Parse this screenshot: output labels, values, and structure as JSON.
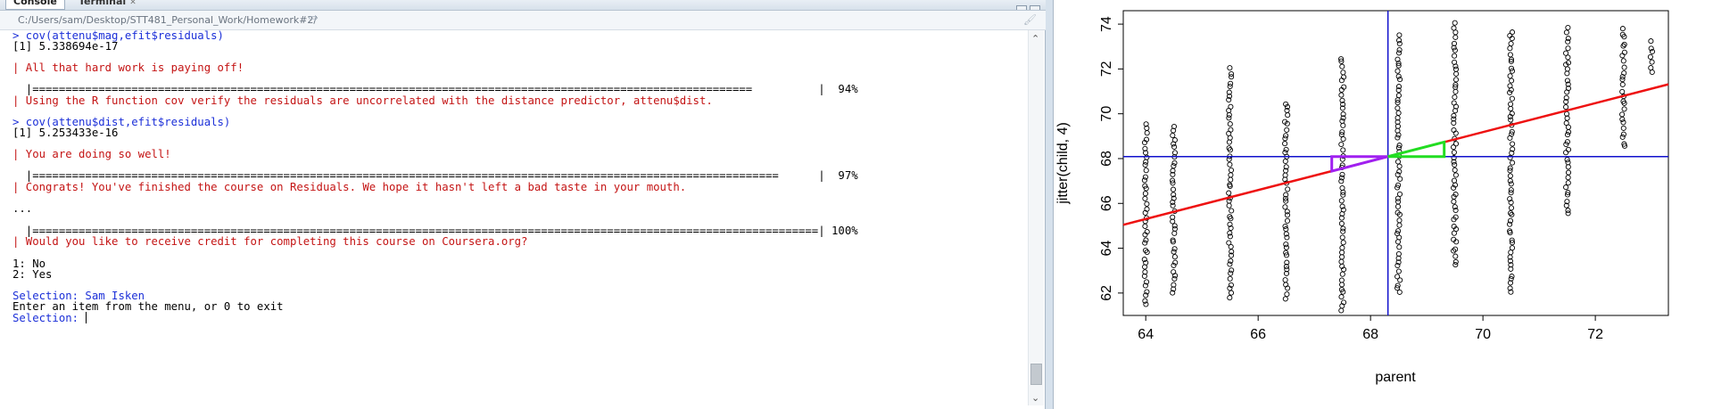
{
  "tabs": [
    {
      "label": "Console"
    },
    {
      "label": "Terminal"
    }
  ],
  "path": "C:/Users/sam/Desktop/STT481_Personal_Work/Homework#2/",
  "console": {
    "lines": [
      {
        "text": "> cov(attenu$mag,efit$residuals)",
        "kind": "cmd"
      },
      {
        "text": "[1] 5.338694e-17",
        "kind": "out"
      },
      {
        "text": "| All that hard work is paying off!",
        "kind": "msg"
      },
      {
        "text": "  |=============================================================================================================          |  94%",
        "kind": "prog"
      },
      {
        "text": "| Using the R function cov verify the residuals are uncorrelated with the distance predictor, attenu$dist.",
        "kind": "msg"
      },
      {
        "text": "> cov(attenu$dist,efit$residuals)",
        "kind": "cmd"
      },
      {
        "text": "[1] 5.253433e-16",
        "kind": "out"
      },
      {
        "text": "| You are doing so well!",
        "kind": "msg"
      },
      {
        "text": "  |=================================================================================================================      |  97%",
        "kind": "prog"
      },
      {
        "text": "| Congrats! You've finished the course on Residuals. We hope it hasn't left a bad taste in your mouth.",
        "kind": "msg"
      },
      {
        "text": "...",
        "kind": "out"
      },
      {
        "text": "  |=======================================================================================================================| 100%",
        "kind": "prog"
      },
      {
        "text": "| Would you like to receive credit for completing this course on Coursera.org?",
        "kind": "msg"
      },
      {
        "text": "1: No",
        "kind": "out"
      },
      {
        "text": "2: Yes",
        "kind": "out"
      },
      {
        "text": "Selection: Sam Isken",
        "kind": "cmd"
      },
      {
        "text": "Enter an item from the menu, or 0 to exit",
        "kind": "out"
      },
      {
        "text": "Selection: ",
        "kind": "cmd"
      }
    ]
  },
  "plot": {
    "xlabel": "parent",
    "ylabel": "jitter(child, 4)",
    "x_ticks": [
      "64",
      "66",
      "68",
      "70",
      "72"
    ],
    "y_ticks": [
      "62",
      "64",
      "66",
      "68",
      "70",
      "72",
      "74"
    ],
    "colors": {
      "regression": "#ee1111",
      "mean_lines": "#1111cc",
      "purple_triangle": "#a020f0",
      "green_triangle": "#22dd22",
      "points": "#000000"
    }
  },
  "chart_data": {
    "type": "scatter",
    "xlabel": "parent",
    "ylabel": "jitter(child, 4)",
    "xlim": [
      63.6,
      73.3
    ],
    "ylim": [
      61,
      74.6
    ],
    "parent_levels": [
      64.0,
      64.5,
      65.5,
      66.5,
      67.5,
      68.5,
      69.5,
      70.5,
      71.5,
      72.5,
      73.0
    ],
    "child_ranges": [
      [
        61.5,
        69.5
      ],
      [
        62.0,
        69.5
      ],
      [
        61.8,
        72.0
      ],
      [
        61.8,
        70.5
      ],
      [
        61.2,
        72.5
      ],
      [
        62.0,
        73.5
      ],
      [
        63.2,
        74.0
      ],
      [
        62.0,
        73.7
      ],
      [
        65.5,
        73.8
      ],
      [
        68.5,
        73.8
      ],
      [
        71.8,
        73.2
      ]
    ],
    "regression": {
      "intercept": 23.94,
      "slope": 0.6463
    },
    "mean_parent": 68.31,
    "mean_child": 68.09,
    "triangles": [
      {
        "color": "purple",
        "points": [
          [
            68.31,
            68.09
          ],
          [
            67.31,
            67.44
          ],
          [
            67.31,
            68.09
          ]
        ]
      },
      {
        "color": "green",
        "points": [
          [
            68.31,
            68.09
          ],
          [
            69.31,
            68.74
          ],
          [
            69.31,
            68.09
          ]
        ]
      }
    ],
    "grid": false
  }
}
